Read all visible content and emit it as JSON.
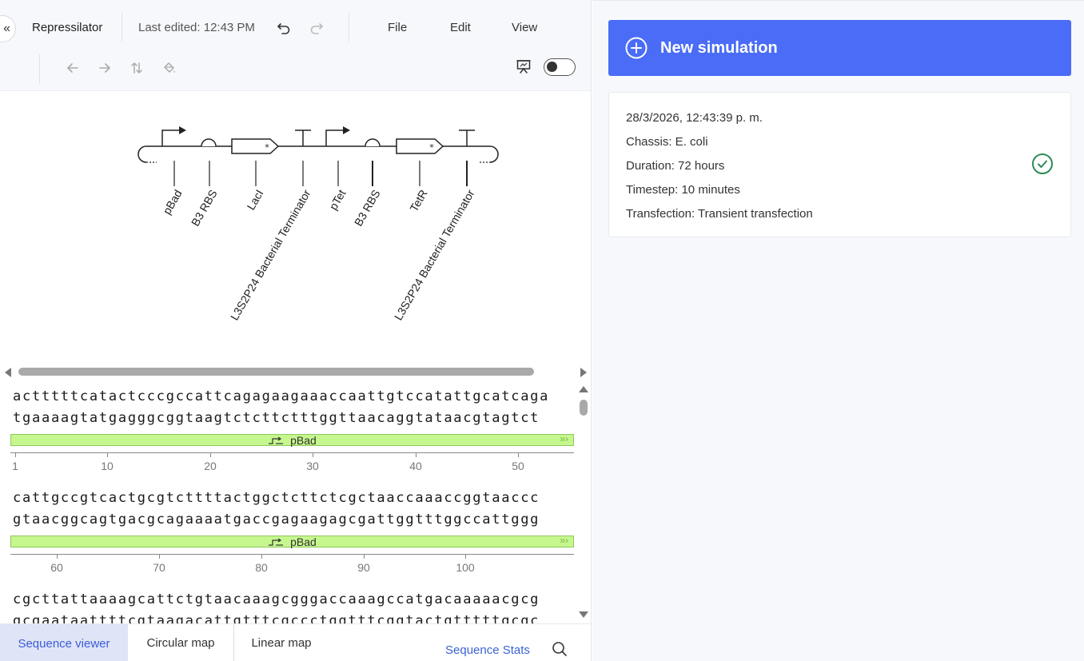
{
  "header": {
    "doc_title": "Repressilator",
    "last_edited": "Last edited: 12:43 PM",
    "menu": [
      "File",
      "Edit",
      "View"
    ]
  },
  "icons": {
    "collapse": "double-chevron-left-icon",
    "undo": "undo-icon",
    "redo": "redo-icon",
    "back": "arrow-left-icon",
    "forward": "arrow-right-icon",
    "swap": "swap-vertical-icon",
    "paint": "paint-bucket-icon",
    "presentation": "presentation-icon",
    "search": "search-icon",
    "check": "check-circle-icon",
    "plus": "plus-circle-icon"
  },
  "diagram": {
    "labels": [
      "pBad",
      "B3 RBS",
      "LacI",
      "L3S2P24 Bacterial Terminator",
      "pTet",
      "B3 RBS",
      "TetR",
      "L3S2P24 Bacterial Terminator"
    ]
  },
  "sequence": {
    "blocks": [
      {
        "top": "actttttcatactcccgccattcagagaagaaaccaattgtccatattgcatcaga",
        "bottom": "tgaaaagtatgagggcggtaagtctcttctttggttaacaggtataacgtagtct",
        "feature": "pBad",
        "ticks": [
          "1",
          "10",
          "20",
          "30",
          "40",
          "50"
        ]
      },
      {
        "top": "cattgccgtcactgcgtcttttactggctcttctcgctaaccaaaccggtaaccc",
        "bottom": "gtaacggcagtgacgcagaaaatgaccgagaagagcgattggtttggccattggg",
        "feature": "pBad",
        "ticks": [
          "60",
          "70",
          "80",
          "90",
          "100"
        ]
      },
      {
        "top": "cgcttattaaaagcattctgtaacaaagcgggaccaaagccatgacaaaaacgcg",
        "bottom": "gcgaataattttcgtaagacattgtttcgccctggtttcggtactgtttttgcgc"
      }
    ]
  },
  "bottom_tabs": {
    "tabs": [
      "Sequence viewer",
      "Circular map",
      "Linear map"
    ],
    "active": "Sequence viewer",
    "stats": "Sequence Stats"
  },
  "simulation": {
    "new_label": "New simulation",
    "card": {
      "timestamp": "28/3/2026, 12:43:39 p. m.",
      "chassis": "Chassis: E. coli",
      "duration": "Duration: 72 hours",
      "timestep": "Timestep: 10 minutes",
      "transfection": "Transfection: Transient transfection"
    }
  },
  "colors": {
    "accent": "#4a6cf7",
    "feature": "#c6f78e",
    "success": "#2e8b57",
    "link": "#3b62d6"
  }
}
